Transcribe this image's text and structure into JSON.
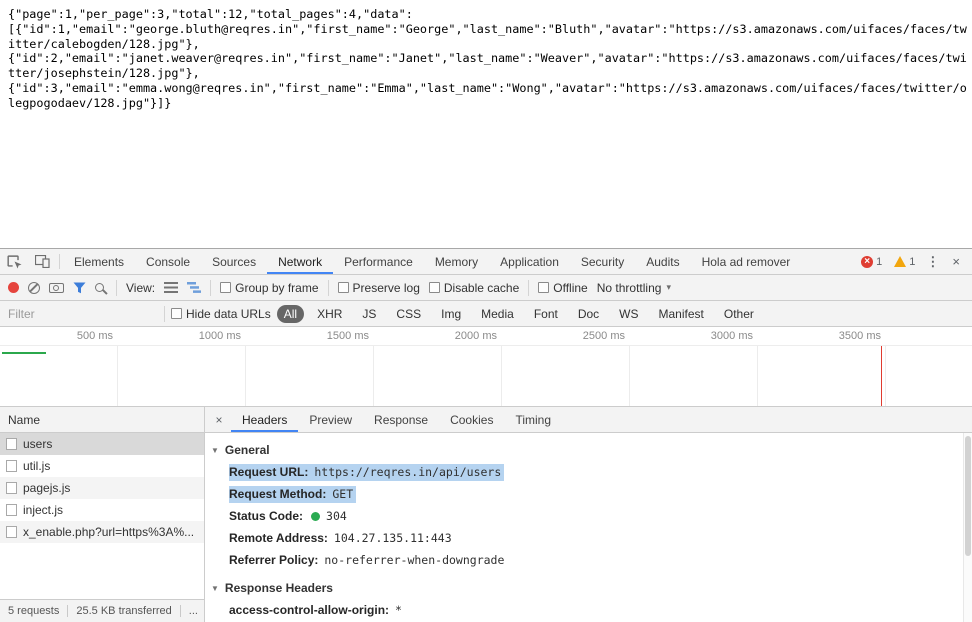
{
  "colors": {
    "accent_blue": "#4285f4",
    "record_red": "#e5443d",
    "warning_yellow": "#f2a60d",
    "status_green": "#2bab52",
    "selection_blue": "#b5d3f0",
    "selected_row_gray": "#d9d9d9"
  },
  "icons": {
    "close": "×",
    "menu": "⋮",
    "collapse": "▼",
    "dropdown": "▾"
  },
  "response_body": {
    "lines": [
      "{\"page\":1,\"per_page\":3,\"total\":12,\"total_pages\":4,\"data\":",
      "[{\"id\":1,\"email\":\"george.bluth@reqres.in\",\"first_name\":\"George\",\"last_name\":\"Bluth\",\"avatar\":\"https://s3.amazonaws.com/uifaces/faces/tw",
      "itter/calebogden/128.jpg\"},",
      "{\"id\":2,\"email\":\"janet.weaver@reqres.in\",\"first_name\":\"Janet\",\"last_name\":\"Weaver\",\"avatar\":\"https://s3.amazonaws.com/uifaces/faces/twi",
      "tter/josephstein/128.jpg\"},",
      "{\"id\":3,\"email\":\"emma.wong@reqres.in\",\"first_name\":\"Emma\",\"last_name\":\"Wong\",\"avatar\":\"https://s3.amazonaws.com/uifaces/faces/twitter/o",
      "legpogodaev/128.jpg\"}]}"
    ]
  },
  "devtools": {
    "main_tabs": {
      "items": [
        "Elements",
        "Console",
        "Sources",
        "Network",
        "Performance",
        "Memory",
        "Application",
        "Security",
        "Audits",
        "Hola ad remover"
      ],
      "selected": "Network"
    },
    "badges": {
      "error_count": "1",
      "warning_count": "1"
    },
    "toolbar": {
      "view_label": "View:",
      "group_by_frame_label": "Group by frame",
      "preserve_log_label": "Preserve log",
      "disable_cache_label": "Disable cache",
      "offline_label": "Offline",
      "throttling_value": "No throttling"
    },
    "filter_bar": {
      "filter_placeholder": "Filter",
      "hide_data_urls_label": "Hide data URLs",
      "type_filters": [
        "All",
        "XHR",
        "JS",
        "CSS",
        "Img",
        "Media",
        "Font",
        "Doc",
        "WS",
        "Manifest",
        "Other"
      ],
      "selected_type": "All"
    },
    "timeline_ticks": [
      "500 ms",
      "1000 ms",
      "1500 ms",
      "2000 ms",
      "2500 ms",
      "3000 ms",
      "3500 ms"
    ],
    "requests_table": {
      "name_header": "Name",
      "rows": [
        {
          "name": "users",
          "selected": true
        },
        {
          "name": "util.js"
        },
        {
          "name": "pagejs.js"
        },
        {
          "name": "inject.js"
        },
        {
          "name": "x_enable.php?url=https%3A%..."
        }
      ]
    },
    "details": {
      "tabs": [
        "Headers",
        "Preview",
        "Response",
        "Cookies",
        "Timing"
      ],
      "selected_tab": "Headers",
      "general_section": {
        "title": "General",
        "request_url_label": "Request URL:",
        "request_url_value": "https://reqres.in/api/users",
        "request_method_label": "Request Method:",
        "request_method_value": "GET",
        "status_code_label": "Status Code:",
        "status_code_value": "304",
        "remote_address_label": "Remote Address:",
        "remote_address_value": "104.27.135.11:443",
        "referrer_policy_label": "Referrer Policy:",
        "referrer_policy_value": "no-referrer-when-downgrade"
      },
      "response_headers_section": {
        "title": "Response Headers",
        "acao_label": "access-control-allow-origin:",
        "acao_value": "*"
      }
    },
    "summary_bar": {
      "requests": "5 requests",
      "transferred": "25.5 KB transferred",
      "more": "..."
    }
  }
}
